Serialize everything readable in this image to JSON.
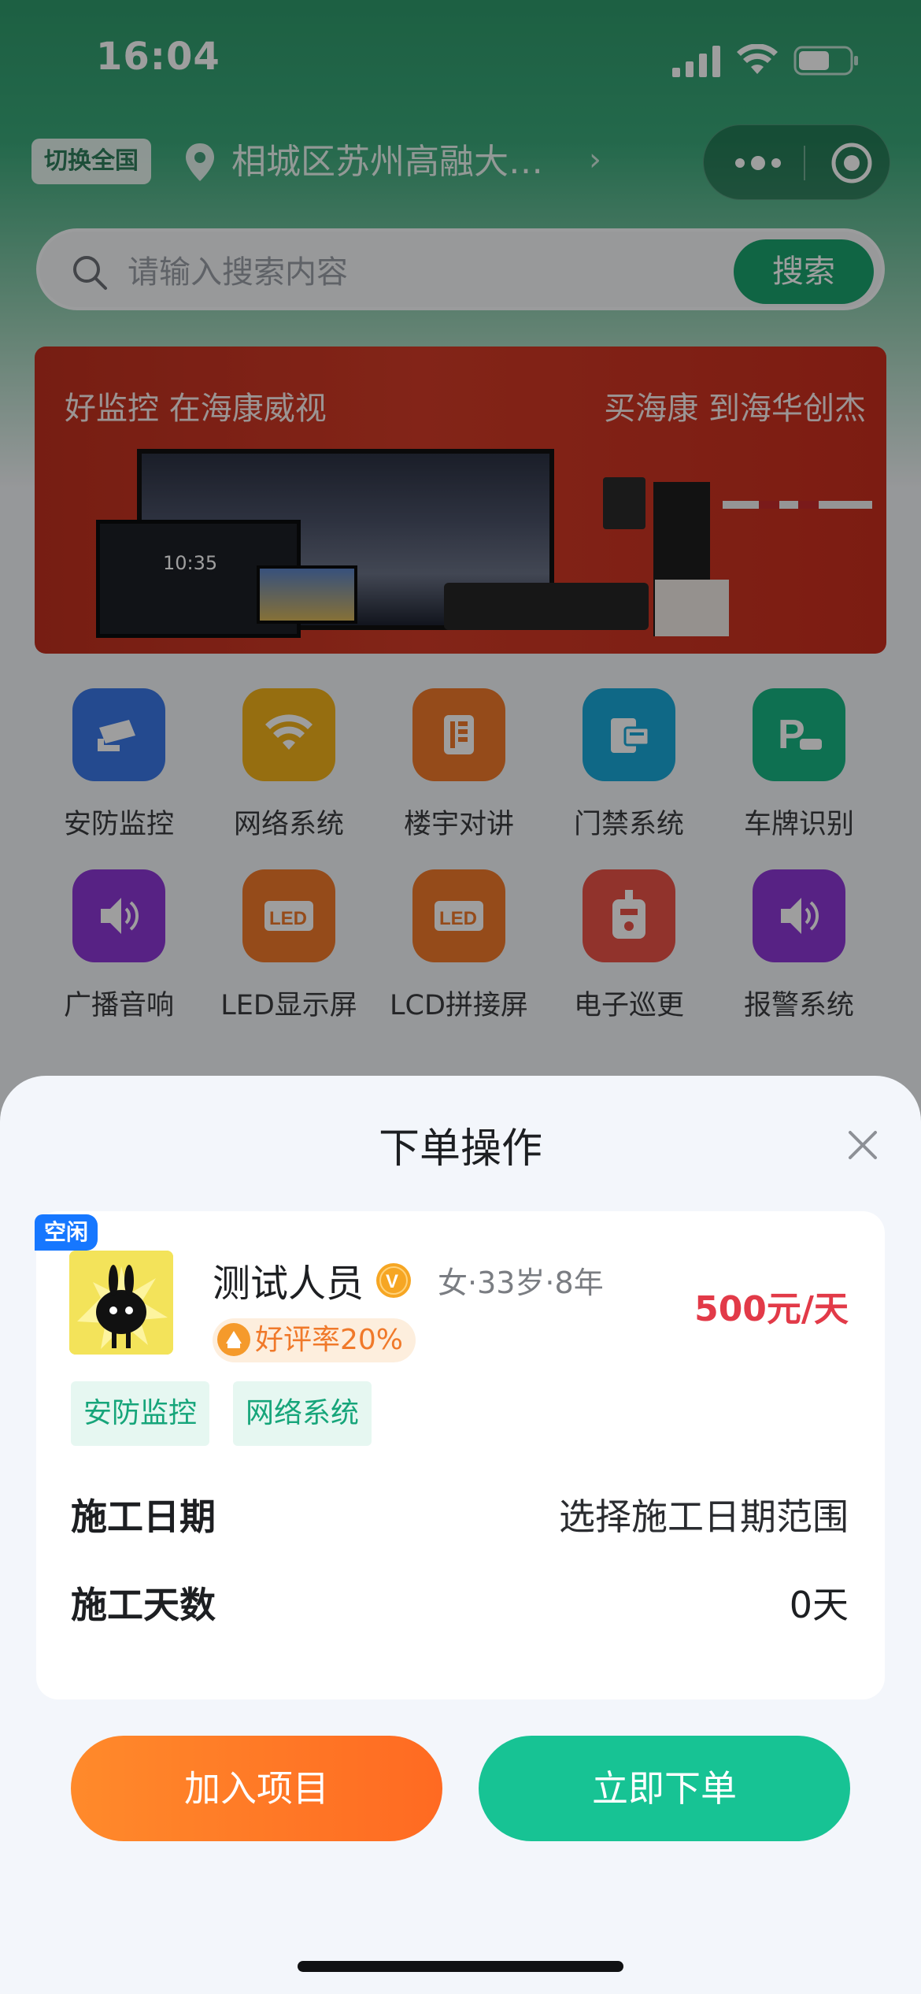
{
  "status_bar": {
    "time": "16:04"
  },
  "location": {
    "switch_label": "切换全国",
    "address": "相城区苏州高融大…",
    "chevron": "›"
  },
  "search": {
    "placeholder": "请输入搜索内容",
    "button": "搜索"
  },
  "banner": {
    "left_slogan": "好监控 在海康威视",
    "right_slogan": "买海康 到海华创杰",
    "clock": "10:35"
  },
  "categories": [
    {
      "label": "安防监控",
      "icon": "camera-icon",
      "color": "#3b78e7"
    },
    {
      "label": "网络系统",
      "icon": "wifi-icon",
      "color": "#f2b21a"
    },
    {
      "label": "楼宇对讲",
      "icon": "intercom-icon",
      "color": "#f07a2a"
    },
    {
      "label": "门禁系统",
      "icon": "access-card-icon",
      "color": "#19a9d8"
    },
    {
      "label": "车牌识别",
      "icon": "parking-icon",
      "color": "#17b584"
    },
    {
      "label": "广播音响",
      "icon": "speaker-icon",
      "color": "#8d37d6"
    },
    {
      "label": "LED显示屏",
      "icon": "led-icon",
      "color": "#f07a2a"
    },
    {
      "label": "LCD拼接屏",
      "icon": "led-icon",
      "color": "#f07a2a"
    },
    {
      "label": "电子巡更",
      "icon": "patrol-icon",
      "color": "#ea5347"
    },
    {
      "label": "报警系统",
      "icon": "speaker-icon",
      "color": "#8d37d6"
    }
  ],
  "sheet": {
    "title": "下单操作",
    "worker": {
      "status_tag": "空闲",
      "name": "测试人员",
      "verified_badge": "V",
      "meta": "女·33岁·8年",
      "price": "500元/天",
      "rating": "好评率20%",
      "skills": [
        "安防监控",
        "网络系统"
      ]
    },
    "rows": [
      {
        "label": "施工日期",
        "value": "选择施工日期范围"
      },
      {
        "label": "施工天数",
        "value": "0天"
      }
    ],
    "buttons": {
      "add": "加入项目",
      "order": "立即下单"
    }
  },
  "colors": {
    "brand_green": "#1aa36f",
    "accent_orange": "#ff7a28",
    "order_green": "#17c394",
    "price_red": "#e23a48",
    "tag_blue": "#1677ff"
  }
}
